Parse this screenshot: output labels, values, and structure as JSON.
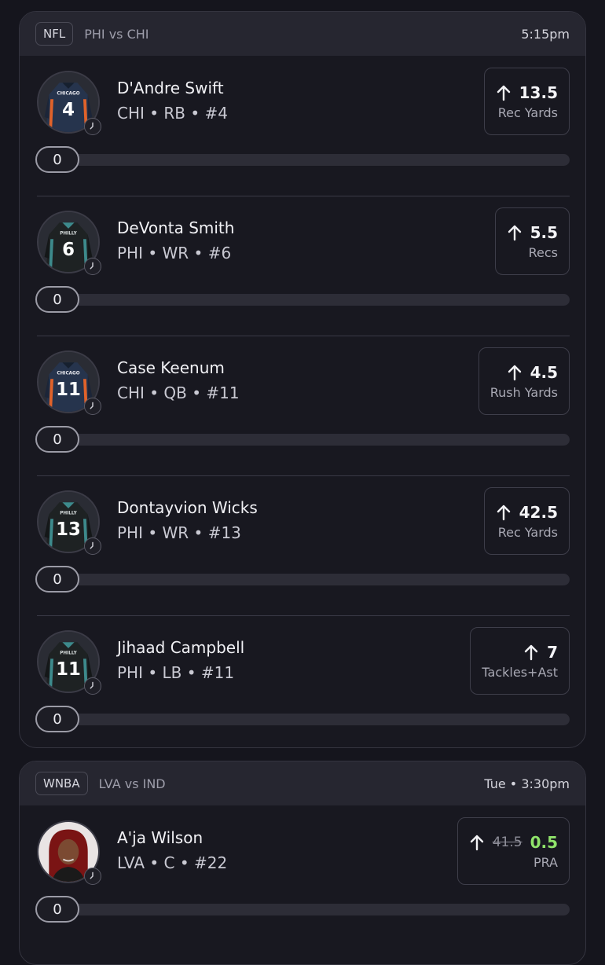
{
  "games": [
    {
      "league": "NFL",
      "matchup": "PHI vs CHI",
      "time": "5:15pm",
      "picks": [
        {
          "name": "D'Andre Swift",
          "meta": "CHI • RB • #4",
          "line": "13.5",
          "stat": "Rec Yards",
          "progress": "0",
          "progress_fraction": 0,
          "jersey_number": "4",
          "jersey_text": "CHICAGO"
        },
        {
          "name": "DeVonta Smith",
          "meta": "PHI • WR • #6",
          "line": "5.5",
          "stat": "Recs",
          "progress": "0",
          "progress_fraction": 0,
          "jersey_number": "6",
          "jersey_text": "PHILLY"
        },
        {
          "name": "Case Keenum",
          "meta": "CHI • QB • #11",
          "line": "4.5",
          "stat": "Rush Yards",
          "progress": "0",
          "progress_fraction": 0,
          "jersey_number": "11",
          "jersey_text": "CHICAGO"
        },
        {
          "name": "Dontayvion Wicks",
          "meta": "PHI • WR • #13",
          "line": "42.5",
          "stat": "Rec Yards",
          "progress": "0",
          "progress_fraction": 0,
          "jersey_number": "13",
          "jersey_text": "PHILLY"
        },
        {
          "name": "Jihaad Campbell",
          "meta": "PHI • LB • #11",
          "line": "7",
          "stat": "Tackles+Ast",
          "progress": "0",
          "progress_fraction": 0,
          "jersey_number": "11",
          "jersey_text": "PHILLY"
        }
      ]
    },
    {
      "league": "WNBA",
      "matchup": "LVA vs IND",
      "time": "Tue • 3:30pm",
      "picks": [
        {
          "name": "A'ja Wilson",
          "meta": "LVA • C • #22",
          "old_line": "41.5",
          "line": "0.5",
          "stat": "PRA",
          "progress": "0",
          "progress_fraction": 0
        }
      ]
    }
  ],
  "colors": {
    "background": "#15151d",
    "card": "#181820",
    "header": "#262630",
    "boosted_line": "#8fe36a",
    "chicago_jersey": "#26344d",
    "chicago_accent": "#e0622a",
    "philly_jersey": "#1e2223",
    "philly_accent": "#3d8a8c"
  },
  "icons": {
    "direction": "arrow-up-icon",
    "badge": "clock-icon"
  }
}
